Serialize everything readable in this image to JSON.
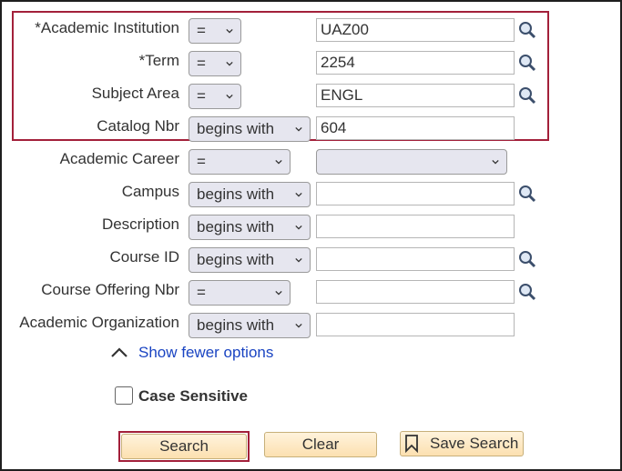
{
  "fields": [
    {
      "label": "*Academic Institution",
      "operator": "=",
      "value": "UAZ00"
    },
    {
      "label": "*Term",
      "operator": "=",
      "value": "2254"
    },
    {
      "label": "Subject Area",
      "operator": "=",
      "value": "ENGL"
    },
    {
      "label": "Catalog Nbr",
      "operator": "begins with",
      "value": "604"
    },
    {
      "label": "Academic Career",
      "operator": "=",
      "value": ""
    },
    {
      "label": "Campus",
      "operator": "begins with",
      "value": ""
    },
    {
      "label": "Description",
      "operator": "begins with",
      "value": ""
    },
    {
      "label": "Course ID",
      "operator": "begins with",
      "value": ""
    },
    {
      "label": "Course Offering Nbr",
      "operator": "=",
      "value": ""
    },
    {
      "label": "Academic Organization",
      "operator": "begins with",
      "value": ""
    }
  ],
  "show_fewer": "Show fewer options",
  "case_sensitive": "Case Sensitive",
  "buttons": {
    "search": "Search",
    "clear": "Clear",
    "save_search": "Save Search"
  },
  "colors": {
    "highlight": "#a3203a",
    "link": "#1a44c2"
  }
}
